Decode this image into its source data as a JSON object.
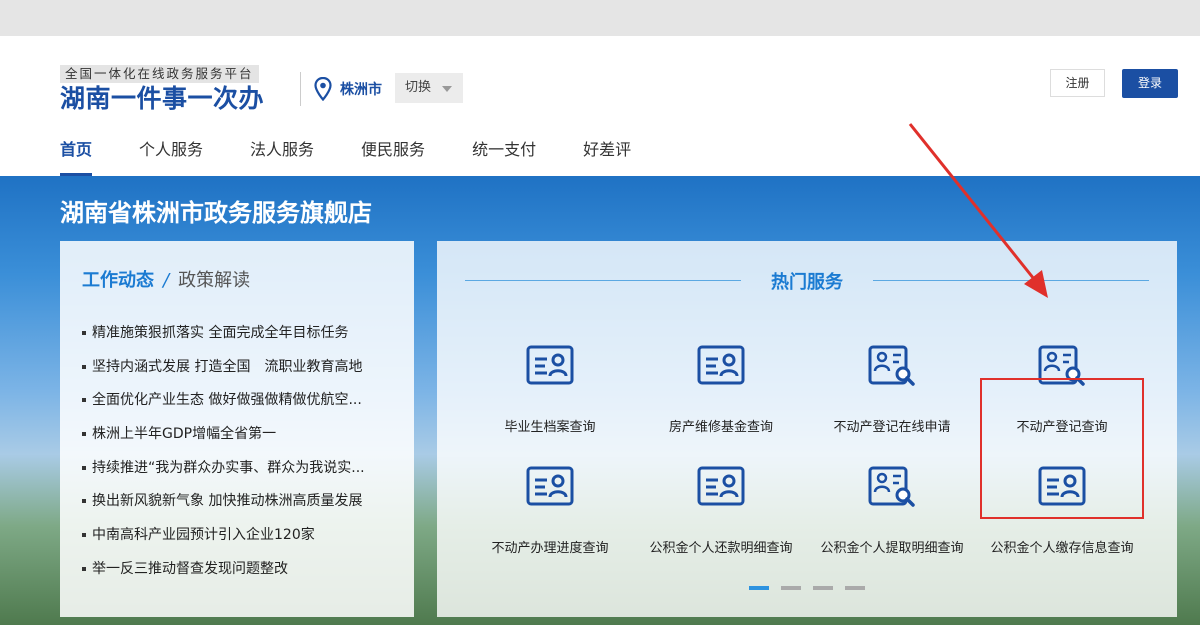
{
  "header": {
    "subtitle": "全国一体化在线政务服务平台",
    "title": "湖南一件事一次办",
    "city": "株洲市",
    "switch_label": "切换",
    "register_label": "注册",
    "login_label": "登录"
  },
  "nav": {
    "items": [
      "首页",
      "个人服务",
      "法人服务",
      "便民服务",
      "统一支付",
      "好差评"
    ],
    "active_index": 0
  },
  "banner": {
    "title": "湖南省株洲市政务服务旗舰店"
  },
  "news": {
    "tab_active": "工作动态",
    "tab_separator": "/",
    "tab_inactive": "政策解读",
    "items": [
      "精准施策狠抓落实 全面完成全年目标任务",
      "坚持内涵式发展 打造全国　流职业教育高地",
      "全面优化产业生态 做好做强做精做优航空...",
      "株洲上半年GDP增幅全省第一",
      "持续推进“我为群众办实事、群众为我说实...",
      "换出新风貌新气象 加快推动株洲高质量发展",
      "中南高科产业园预计引入企业120家",
      "举一反三推动督查发现问题整改"
    ]
  },
  "hot_services": {
    "title": "热门服务",
    "items": [
      {
        "label": "毕业生档案查询",
        "icon": "person-card-icon"
      },
      {
        "label": "房产维修基金查询",
        "icon": "person-card-icon"
      },
      {
        "label": "不动产登记在线申请",
        "icon": "document-search-icon"
      },
      {
        "label": "不动产登记查询",
        "icon": "document-search-icon"
      },
      {
        "label": "不动产办理进度查询",
        "icon": "person-card-icon"
      },
      {
        "label": "公积金个人还款明细查询",
        "icon": "person-card-icon"
      },
      {
        "label": "公积金个人提取明细查询",
        "icon": "document-search-icon"
      },
      {
        "label": "公积金个人缴存信息查询",
        "icon": "person-card-icon"
      }
    ],
    "highlighted_index": 3,
    "pager_count": 4,
    "pager_active": 0
  },
  "colors": {
    "brand": "#1b4fa3",
    "accent": "#1b7bd2",
    "annotation": "#e0302b"
  }
}
